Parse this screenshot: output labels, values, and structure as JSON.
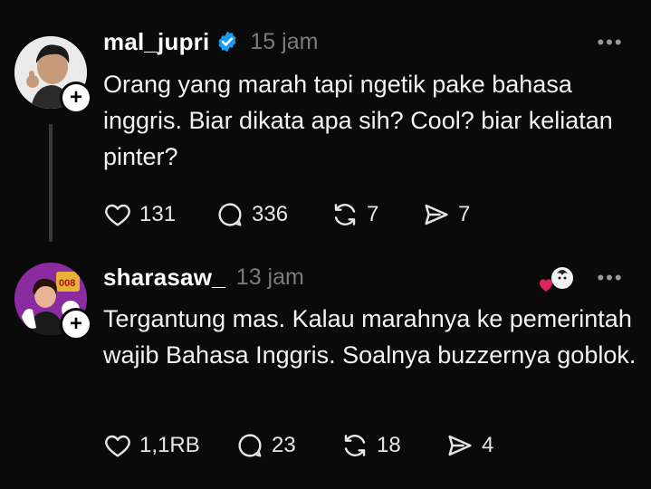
{
  "posts": [
    {
      "username": "mal_jupri",
      "verified": true,
      "timestamp": "15 jam",
      "text": "Orang yang marah tapi ngetik pake bahasa inggris. Biar dikata apa sih? Cool? biar keliatan pinter?",
      "counts": {
        "likes": "131",
        "replies": "336",
        "reposts": "7",
        "shares": "7"
      },
      "avatar_icon": "profile-photo",
      "follow_icon": "plus-icon",
      "more_label": "..."
    },
    {
      "username": "sharasaw_",
      "verified": false,
      "timestamp": "13 jam",
      "text": "Tergantung mas. Kalau marahnya ke pemerintah wajib Bahasa Inggris. Soalnya buzzernya goblok.",
      "counts": {
        "likes": "1,1RB",
        "replies": "23",
        "reposts": "18",
        "shares": "4"
      },
      "avatar_icon": "profile-photo",
      "avatar_badge_text": "008",
      "follow_icon": "plus-icon",
      "more_label": "...",
      "liked_by_author_icon": "heart-avatar-icon"
    }
  ],
  "colors": {
    "background": "#0a0a0a",
    "text": "#f3f3f3",
    "muted": "#7b7b7b",
    "verified": "#1d9bf0",
    "heart": "#e0245e"
  }
}
